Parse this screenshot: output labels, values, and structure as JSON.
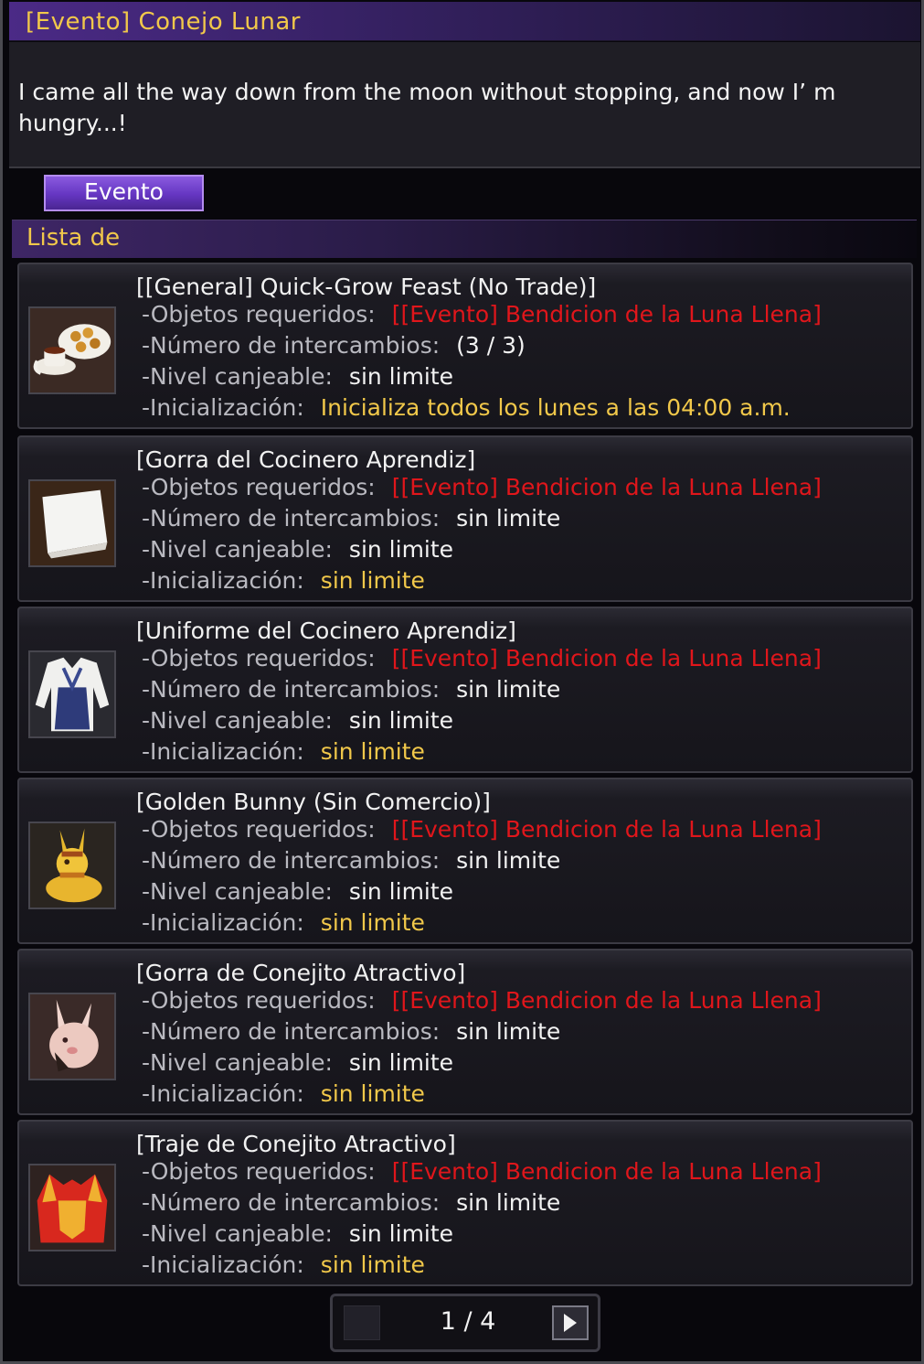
{
  "window": {
    "title": "[Evento] Conejo Lunar",
    "dialog_text": "I came all the way down from the moon without stopping, and now I’ m hungry...!"
  },
  "tabs": [
    {
      "label": "Evento",
      "active": true
    }
  ],
  "list": {
    "header": "Lista de",
    "labels": {
      "required": "-Objetos requeridos:",
      "exchanges": "-Número de intercambios:",
      "level": "-Nivel canjeable:",
      "reset": "-Inicialización:"
    },
    "items": [
      {
        "name": "[[General] Quick-Grow Feast (No Trade)]",
        "icon": "feast-icon",
        "required": "[[Evento] Bendicion de la Luna Llena]",
        "exchanges": "(3 / 3)",
        "level": "sin limite",
        "reset": "Inicializa todos los lunes a las 04:00 a.m."
      },
      {
        "name": "[Gorra del Cocinero Aprendiz]",
        "icon": "chef-hat-icon",
        "required": "[[Evento] Bendicion de la Luna Llena]",
        "exchanges": "sin limite",
        "level": "sin limite",
        "reset": "sin limite"
      },
      {
        "name": "[Uniforme del Cocinero Aprendiz]",
        "icon": "chef-uniform-icon",
        "required": "[[Evento] Bendicion de la Luna Llena]",
        "exchanges": "sin limite",
        "level": "sin limite",
        "reset": "sin limite"
      },
      {
        "name": "[Golden Bunny (Sin Comercio)]",
        "icon": "golden-bunny-icon",
        "required": "[[Evento] Bendicion de la Luna Llena]",
        "exchanges": "sin limite",
        "level": "sin limite",
        "reset": "sin limite"
      },
      {
        "name": "[Gorra de Conejito Atractivo]",
        "icon": "bunny-hat-icon",
        "required": "[[Evento] Bendicion de la Luna Llena]",
        "exchanges": "sin limite",
        "level": "sin limite",
        "reset": "sin limite"
      },
      {
        "name": "[Traje de Conejito Atractivo]",
        "icon": "bunny-suit-icon",
        "required": "[[Evento] Bendicion de la Luna Llena]",
        "exchanges": "sin limite",
        "level": "sin limite",
        "reset": "sin limite"
      }
    ]
  },
  "pager": {
    "current": "1 / 4",
    "prev_icon": "prev-page-icon",
    "next_icon": "next-page-icon"
  },
  "colors": {
    "title": "#f1c84a",
    "required_item": "#e0161b",
    "limit_value": "#f1c84a",
    "tab_accent": "#6536c2"
  }
}
